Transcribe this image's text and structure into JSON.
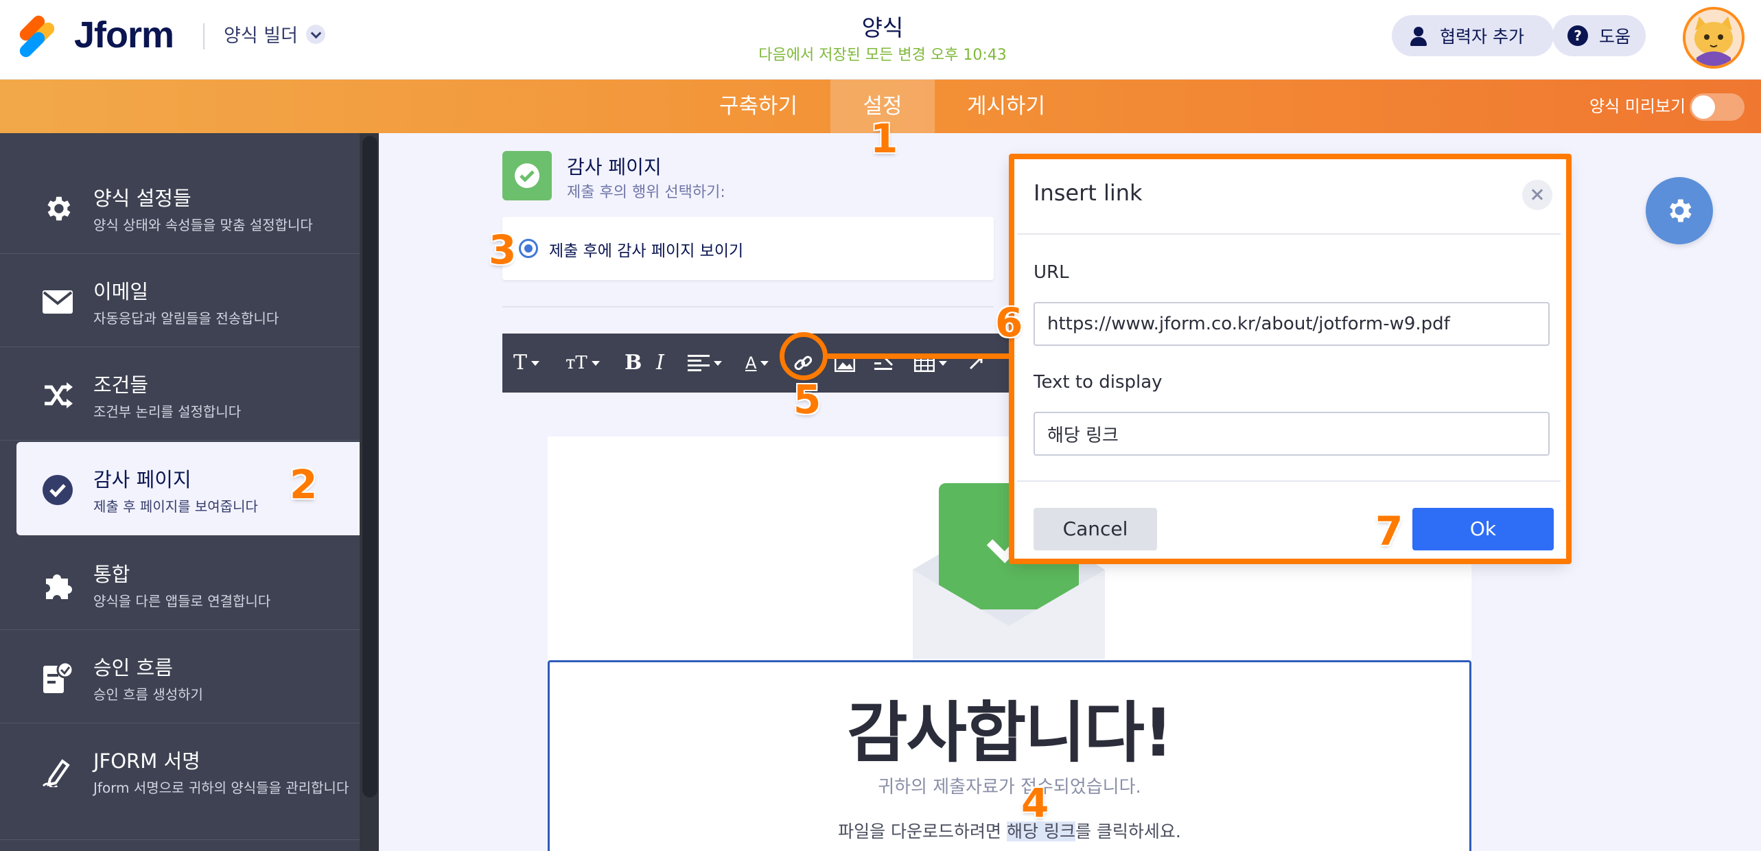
{
  "app": {
    "logo_text": "Jform",
    "builder_label": "양식 빌더",
    "form_title": "양식",
    "save_status": "다음에서 저장된 모든 변경 오후 10:43",
    "add_collaborator": "협력자 추가",
    "help": "도움"
  },
  "tabs": [
    {
      "label": "구축하기"
    },
    {
      "label": "설정"
    },
    {
      "label": "게시하기"
    }
  ],
  "preview": {
    "label": "양식 미리보기",
    "enabled": false
  },
  "sidebar": {
    "items": [
      {
        "title": "양식 설정들",
        "desc": "양식 상태와 속성들을 맞춤 설정합니다",
        "icon": "gear-icon"
      },
      {
        "title": "이메일",
        "desc": "자동응답과 알림들을 전송합니다",
        "icon": "envelope-icon"
      },
      {
        "title": "조건들",
        "desc": "조건부 논리를 설정합니다",
        "icon": "shuffle-icon"
      },
      {
        "title": "감사 페이지",
        "desc": "제출 후 페이지를 보여줍니다",
        "icon": "check-circle-icon"
      },
      {
        "title": "통합",
        "desc": "양식을 다른 앱들로 연결합니다",
        "icon": "puzzle-icon"
      },
      {
        "title": "승인 흐름",
        "desc": "승인 흐름 생성하기",
        "icon": "approval-icon"
      },
      {
        "title": "JFORM 서명",
        "desc": "Jform 서명으로 귀하의 양식들을 관리합니다",
        "icon": "pen-icon"
      }
    ]
  },
  "thank_you": {
    "title": "감사 페이지",
    "subtitle": "제출 후의 행위 선택하기:",
    "option_label": "제출 후에 감사 페이지 보이기",
    "heading": "감사합니다!",
    "message": "귀하의 제출자료가 접수되었습니다.",
    "download_prefix": "파일을 다운로드하려면 ",
    "download_link": "해당 링크",
    "download_suffix": "를 클릭하세요."
  },
  "toolbar": {
    "font": "T",
    "font_size": "тT",
    "bold": "B",
    "italic": "I",
    "color": "A"
  },
  "dialog": {
    "title": "Insert link",
    "url_label": "URL",
    "url_value": "https://www.jform.co.kr/about/jotform-w9.pdf",
    "display_label": "Text to display",
    "display_value": "해당 링크",
    "cancel": "Cancel",
    "ok": "Ok"
  },
  "steps": [
    "1",
    "2",
    "3",
    "4",
    "5",
    "6",
    "7"
  ],
  "colors": {
    "accent_orange": "#ff7a00",
    "ok_blue": "#2e6df6",
    "sidebar_bg": "#3e4252",
    "success_green": "#6cbf6c"
  }
}
